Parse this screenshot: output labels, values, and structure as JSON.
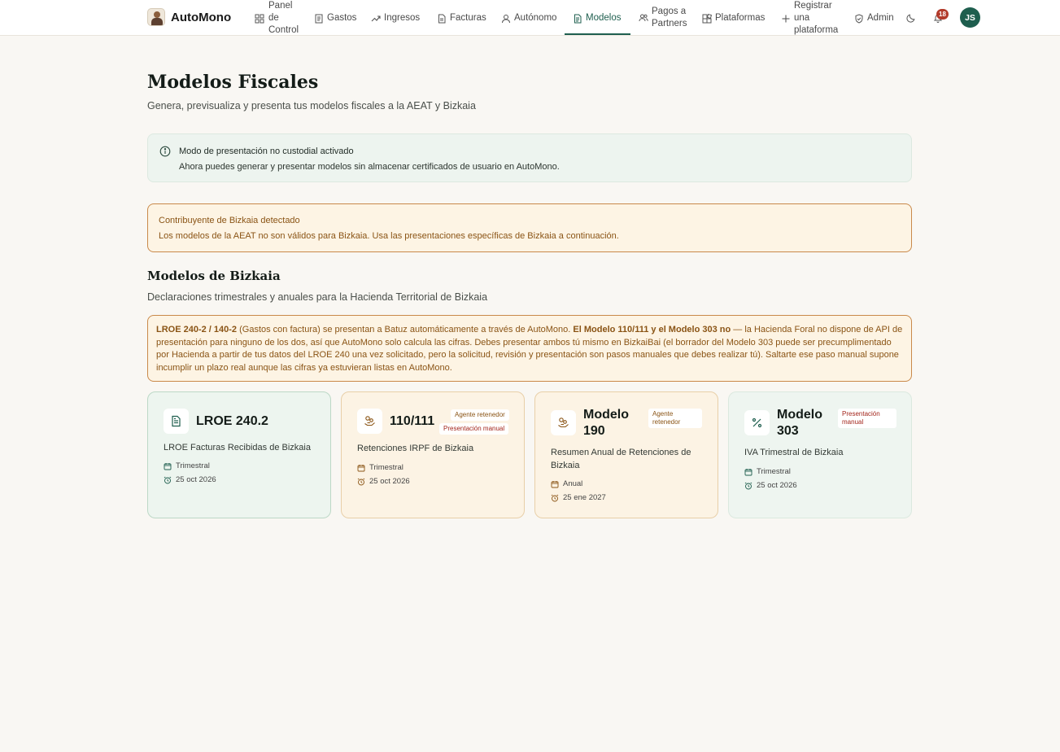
{
  "brand": {
    "name": "AutoMono"
  },
  "nav": {
    "panel": [
      "Panel",
      "de",
      "Control"
    ],
    "gastos": "Gastos",
    "ingresos": "Ingresos",
    "facturas": "Facturas",
    "autonomo": "Autónomo",
    "modelos": "Modelos",
    "pagos": [
      "Pagos a",
      "Partners"
    ],
    "plataformas": "Plataformas",
    "registrar": [
      "Registrar",
      "una",
      "plataforma"
    ],
    "admin": "Admin"
  },
  "notifications": {
    "count": "18"
  },
  "user": {
    "initials": "JS"
  },
  "page": {
    "title": "Modelos Fiscales",
    "subtitle": "Genera, previsualiza y presenta tus modelos fiscales a la AEAT y Bizkaia"
  },
  "info_banner": {
    "title": "Modo de presentación no custodial activado",
    "text": "Ahora puedes generar y presentar modelos sin almacenar certificados de usuario en AutoMono."
  },
  "warning_banner": {
    "title": "Contribuyente de Bizkaia detectado",
    "text": "Los modelos de la AEAT no son válidos para Bizkaia. Usa las presentaciones específicas de Bizkaia a continuación."
  },
  "section": {
    "title": "Modelos de Bizkaia",
    "subtitle": "Declaraciones trimestrales y anuales para la Hacienda Territorial de Bizkaia"
  },
  "note": {
    "bold1": "LROE 240-2 / 140-2",
    "text1": " (Gastos con factura) se presentan a Batuz automáticamente a través de AutoMono. ",
    "bold2": "El Modelo 110/111 y el Modelo 303 no",
    "text2": " — la Hacienda Foral no dispone de API de presentación para ninguno de los dos, así que AutoMono solo calcula las cifras. Debes presentar ambos tú mismo en BizkaiBai (el borrador del Modelo 303 puede ser precumplimentado por Hacienda a partir de tus datos del LROE 240 una vez solicitado, pero la solicitud, revisión y presentación son pasos manuales que debes realizar tú). Saltarte ese paso manual supone incumplir un plazo real aunque las cifras ya estuvieran listas en AutoMono."
  },
  "cards": [
    {
      "title": "LROE 240.2",
      "tags": [],
      "description": "LROE Facturas Recibidas de Bizkaia",
      "period": "Trimestral",
      "deadline": "25 oct 2026"
    },
    {
      "title": "110/111",
      "tags": [
        "Agente retenedor",
        "Presentación manual"
      ],
      "description": "Retenciones IRPF de Bizkaia",
      "period": "Trimestral",
      "deadline": "25 oct 2026"
    },
    {
      "title_lines": [
        "Modelo",
        "190"
      ],
      "tags": [
        "Agente retenedor"
      ],
      "description": "Resumen Anual de Retenciones de Bizkaia",
      "period": "Anual",
      "deadline": "25 ene 2027"
    },
    {
      "title_lines": [
        "Modelo",
        "303"
      ],
      "tags": [
        "Presentación manual"
      ],
      "description": "IVA Trimestral de Bizkaia",
      "period": "Trimestral",
      "deadline": "25 oct 2026"
    }
  ],
  "colors": {
    "primary": "#1e5e4e",
    "warning": "#8a5415",
    "danger": "#b23a2a"
  }
}
